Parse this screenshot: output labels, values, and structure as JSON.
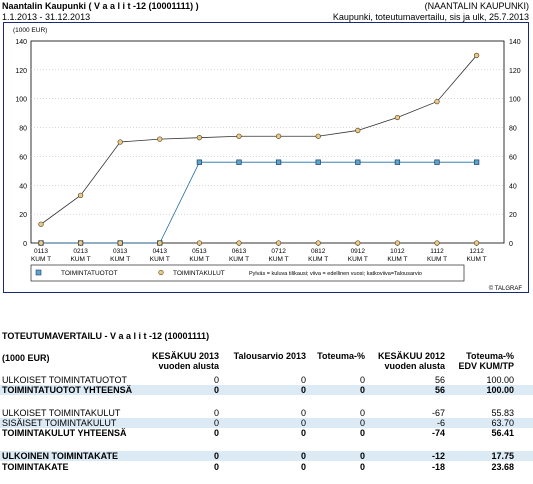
{
  "header": {
    "title": "Naantalin Kaupunki ( V a a l i t  -12 (10001111) )",
    "period": "1.1.2013 - 31.12.2013",
    "org": "(NAANTALIN KAUPUNKI)",
    "subtitle": "Kaupunki, toteutumavertailu, sis ja ulk, 25.7.2013"
  },
  "chart_data": {
    "type": "line",
    "unit_label": "(1000 EUR)",
    "ylim": [
      0,
      140
    ],
    "yticks": [
      0,
      20,
      40,
      60,
      80,
      100,
      120,
      140
    ],
    "categories": [
      "0113 KUM T",
      "0213 KUM T",
      "0313 KUM T",
      "0413 KUM T",
      "0513 KUM T",
      "0613 KUM T",
      "0712 KUM T",
      "0812 KUM T",
      "0912 KUM T",
      "1012 KUM T",
      "1112 KUM T",
      "1212 KUM T"
    ],
    "grid": true,
    "series": [
      {
        "name": "TOIMINTATUOTOT",
        "marker": "square",
        "color": "#1f6fa6",
        "values": [
          0,
          0,
          0,
          0,
          56,
          56,
          56,
          56,
          56,
          56,
          56,
          56
        ]
      },
      {
        "name": "TOIMINTAKULUT",
        "marker": "circle",
        "color": "#c8a24a",
        "values": [
          13,
          33,
          70,
          72,
          73,
          74,
          74,
          74,
          78,
          87,
          98,
          130
        ]
      },
      {
        "name": "TOIMINTAKULUT (bars)",
        "marker": "circle",
        "color": "#c8a24a",
        "values": [
          0,
          0,
          0,
          0,
          0,
          0,
          0,
          0,
          0,
          0,
          0,
          0
        ]
      }
    ],
    "legend_note": "Pylväs = kuluva tilikausi; viiva = edellinen vuosi; katkoviiva=Talousarvio",
    "copyright": "© TALGRAF"
  },
  "table": {
    "title": "TOTEUTUMAVERTAILU - V a a l i t  -12 (10001111)",
    "headers": {
      "label": "(1000 EUR)",
      "c1a": "KESÄKUU 2013",
      "c1b": "vuoden alusta",
      "c2": "Talousarvio 2013",
      "c3": "Toteuma-%",
      "c4a": "KESÄKUU 2012",
      "c4b": "vuoden alusta",
      "c5a": "Toteuma-%",
      "c5b": "EDV KUM/TP"
    },
    "rows": [
      {
        "label": "ULKOISET TOIMINTATUOTOT",
        "c1": "0",
        "c2": "0",
        "c3": "0",
        "c4": "56",
        "c5": "100.00",
        "bold": false,
        "bg": false
      },
      {
        "label": "TOIMINTATUOTOT YHTEENSÄ",
        "c1": "0",
        "c2": "0",
        "c3": "0",
        "c4": "56",
        "c5": "100.00",
        "bold": true,
        "bg": true
      },
      {
        "label": "ULKOISET TOIMINTAKULUT",
        "c1": "0",
        "c2": "0",
        "c3": "0",
        "c4": "-67",
        "c5": "55.83",
        "bold": false,
        "bg": false
      },
      {
        "label": "SISÄISET TOIMINTAKULUT",
        "c1": "0",
        "c2": "0",
        "c3": "0",
        "c4": "-6",
        "c5": "63.70",
        "bold": false,
        "bg": true
      },
      {
        "label": "TOIMINTAKULUT YHTEENSÄ",
        "c1": "0",
        "c2": "0",
        "c3": "0",
        "c4": "-74",
        "c5": "56.41",
        "bold": true,
        "bg": false
      },
      {
        "label": "ULKOINEN TOIMINTAKATE",
        "c1": "0",
        "c2": "0",
        "c3": "0",
        "c4": "-12",
        "c5": "17.75",
        "bold": true,
        "bg": true
      },
      {
        "label": "TOIMINTAKATE",
        "c1": "0",
        "c2": "0",
        "c3": "0",
        "c4": "-18",
        "c5": "23.68",
        "bold": true,
        "bg": false
      }
    ]
  }
}
